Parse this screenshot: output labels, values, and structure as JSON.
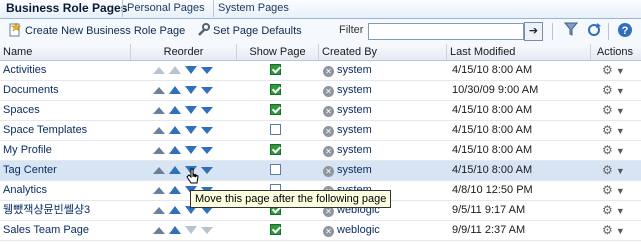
{
  "tabs": [
    {
      "label": "Business Role Pages",
      "active": true
    },
    {
      "label": "Personal Pages",
      "active": false
    },
    {
      "label": "System Pages",
      "active": false
    }
  ],
  "toolbar": {
    "create_label": "Create New Business Role Page",
    "defaults_label": "Set Page Defaults",
    "filter_label": "Filter",
    "filter_value": "",
    "go_icon": "arrow-right-icon",
    "filter_icon": "funnel-icon",
    "refresh_icon": "refresh-icon",
    "help_icon": "help-icon"
  },
  "columns": {
    "name": "Name",
    "reorder": "Reorder",
    "show": "Show Page",
    "created_by": "Created By",
    "last_modified": "Last Modified",
    "actions": "Actions"
  },
  "rows": [
    {
      "name": "Activities",
      "show": true,
      "creator": "system",
      "modified": "4/15/10 8:00 AM"
    },
    {
      "name": "Documents",
      "show": true,
      "creator": "system",
      "modified": "10/30/09 9:00 AM"
    },
    {
      "name": "Spaces",
      "show": true,
      "creator": "system",
      "modified": "4/15/10 8:00 AM"
    },
    {
      "name": "Space Templates",
      "show": false,
      "creator": "system",
      "modified": "4/15/10 8:00 AM"
    },
    {
      "name": "My Profile",
      "show": true,
      "creator": "system",
      "modified": "4/15/10 8:00 AM"
    },
    {
      "name": "Tag Center",
      "show": false,
      "creator": "system",
      "modified": "4/15/10 8:00 AM",
      "selected": true
    },
    {
      "name": "Analytics",
      "show": false,
      "creator": "system",
      "modified": "4/8/10 12:50 PM"
    },
    {
      "name": "뒝뺐잭샹뮨빈쎌샹3",
      "show": true,
      "creator": "weblogic",
      "modified": "9/5/11 9:17 AM"
    },
    {
      "name": "Sales Team Page",
      "show": true,
      "creator": "weblogic",
      "modified": "9/9/11 2:37 AM"
    }
  ],
  "tooltip": "Move this page after the following page"
}
